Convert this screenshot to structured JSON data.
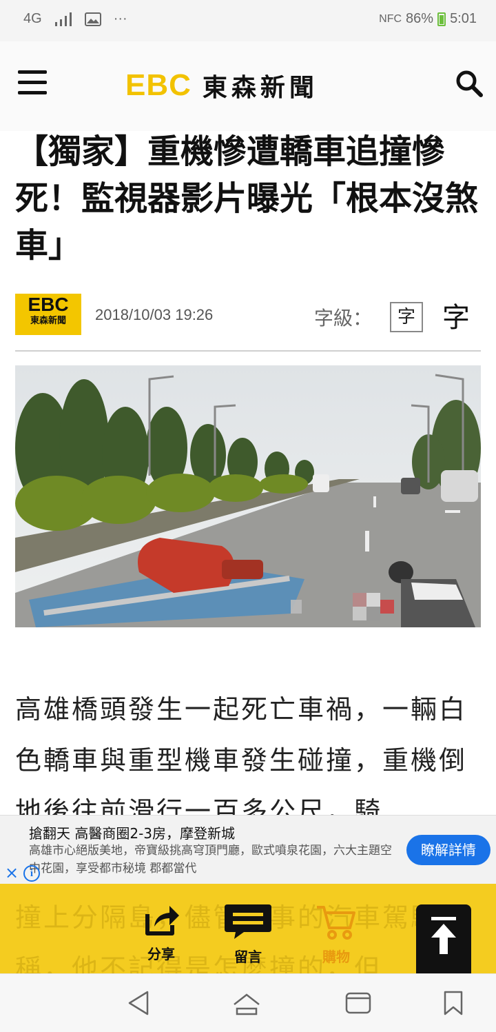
{
  "status_bar": {
    "network": "4G",
    "nfc": "NFC",
    "battery": "86%",
    "time": "5:01",
    "more": "···"
  },
  "header": {
    "logo_mark": "EBC",
    "logo_text": "東森新聞"
  },
  "article": {
    "headline": "【獨家】重機慘遭轎車追撞慘死！監視器影片曝光「根本沒煞車」",
    "source_logo_mark": "EBC",
    "source_logo_text": "東森新聞",
    "date": "2018/10/03 19:26",
    "font_size_label": "字級：",
    "font_small_label": "字",
    "font_large_label": "字",
    "body": "高雄橋頭發生一起死亡車禍，一輛白色轎車與重型機車發生碰撞，重機倒地後往前滑行一百多公尺，騎"
  },
  "ad": {
    "title": "搶翻天 高醫商圈2-3房，摩登新城",
    "description": "高雄市心絕版美地，帝寶級挑高穹頂門廳，歐式噴泉花園，六大主題空中花園，享受都市秘境 郡都當代",
    "cta": "瞭解詳情",
    "close": "×",
    "info": "i"
  },
  "action_bar": {
    "bg_text": "撞上分隔島，儘管肇事的汽車駕駛聲稱，他不記得是怎麼撞的，但",
    "share": "分享",
    "comment": "留言",
    "buy": "購物"
  },
  "colors": {
    "brand_yellow": "#f3c600",
    "action_bar_yellow": "#f4cc20",
    "ad_button_blue": "#1a73e8"
  }
}
